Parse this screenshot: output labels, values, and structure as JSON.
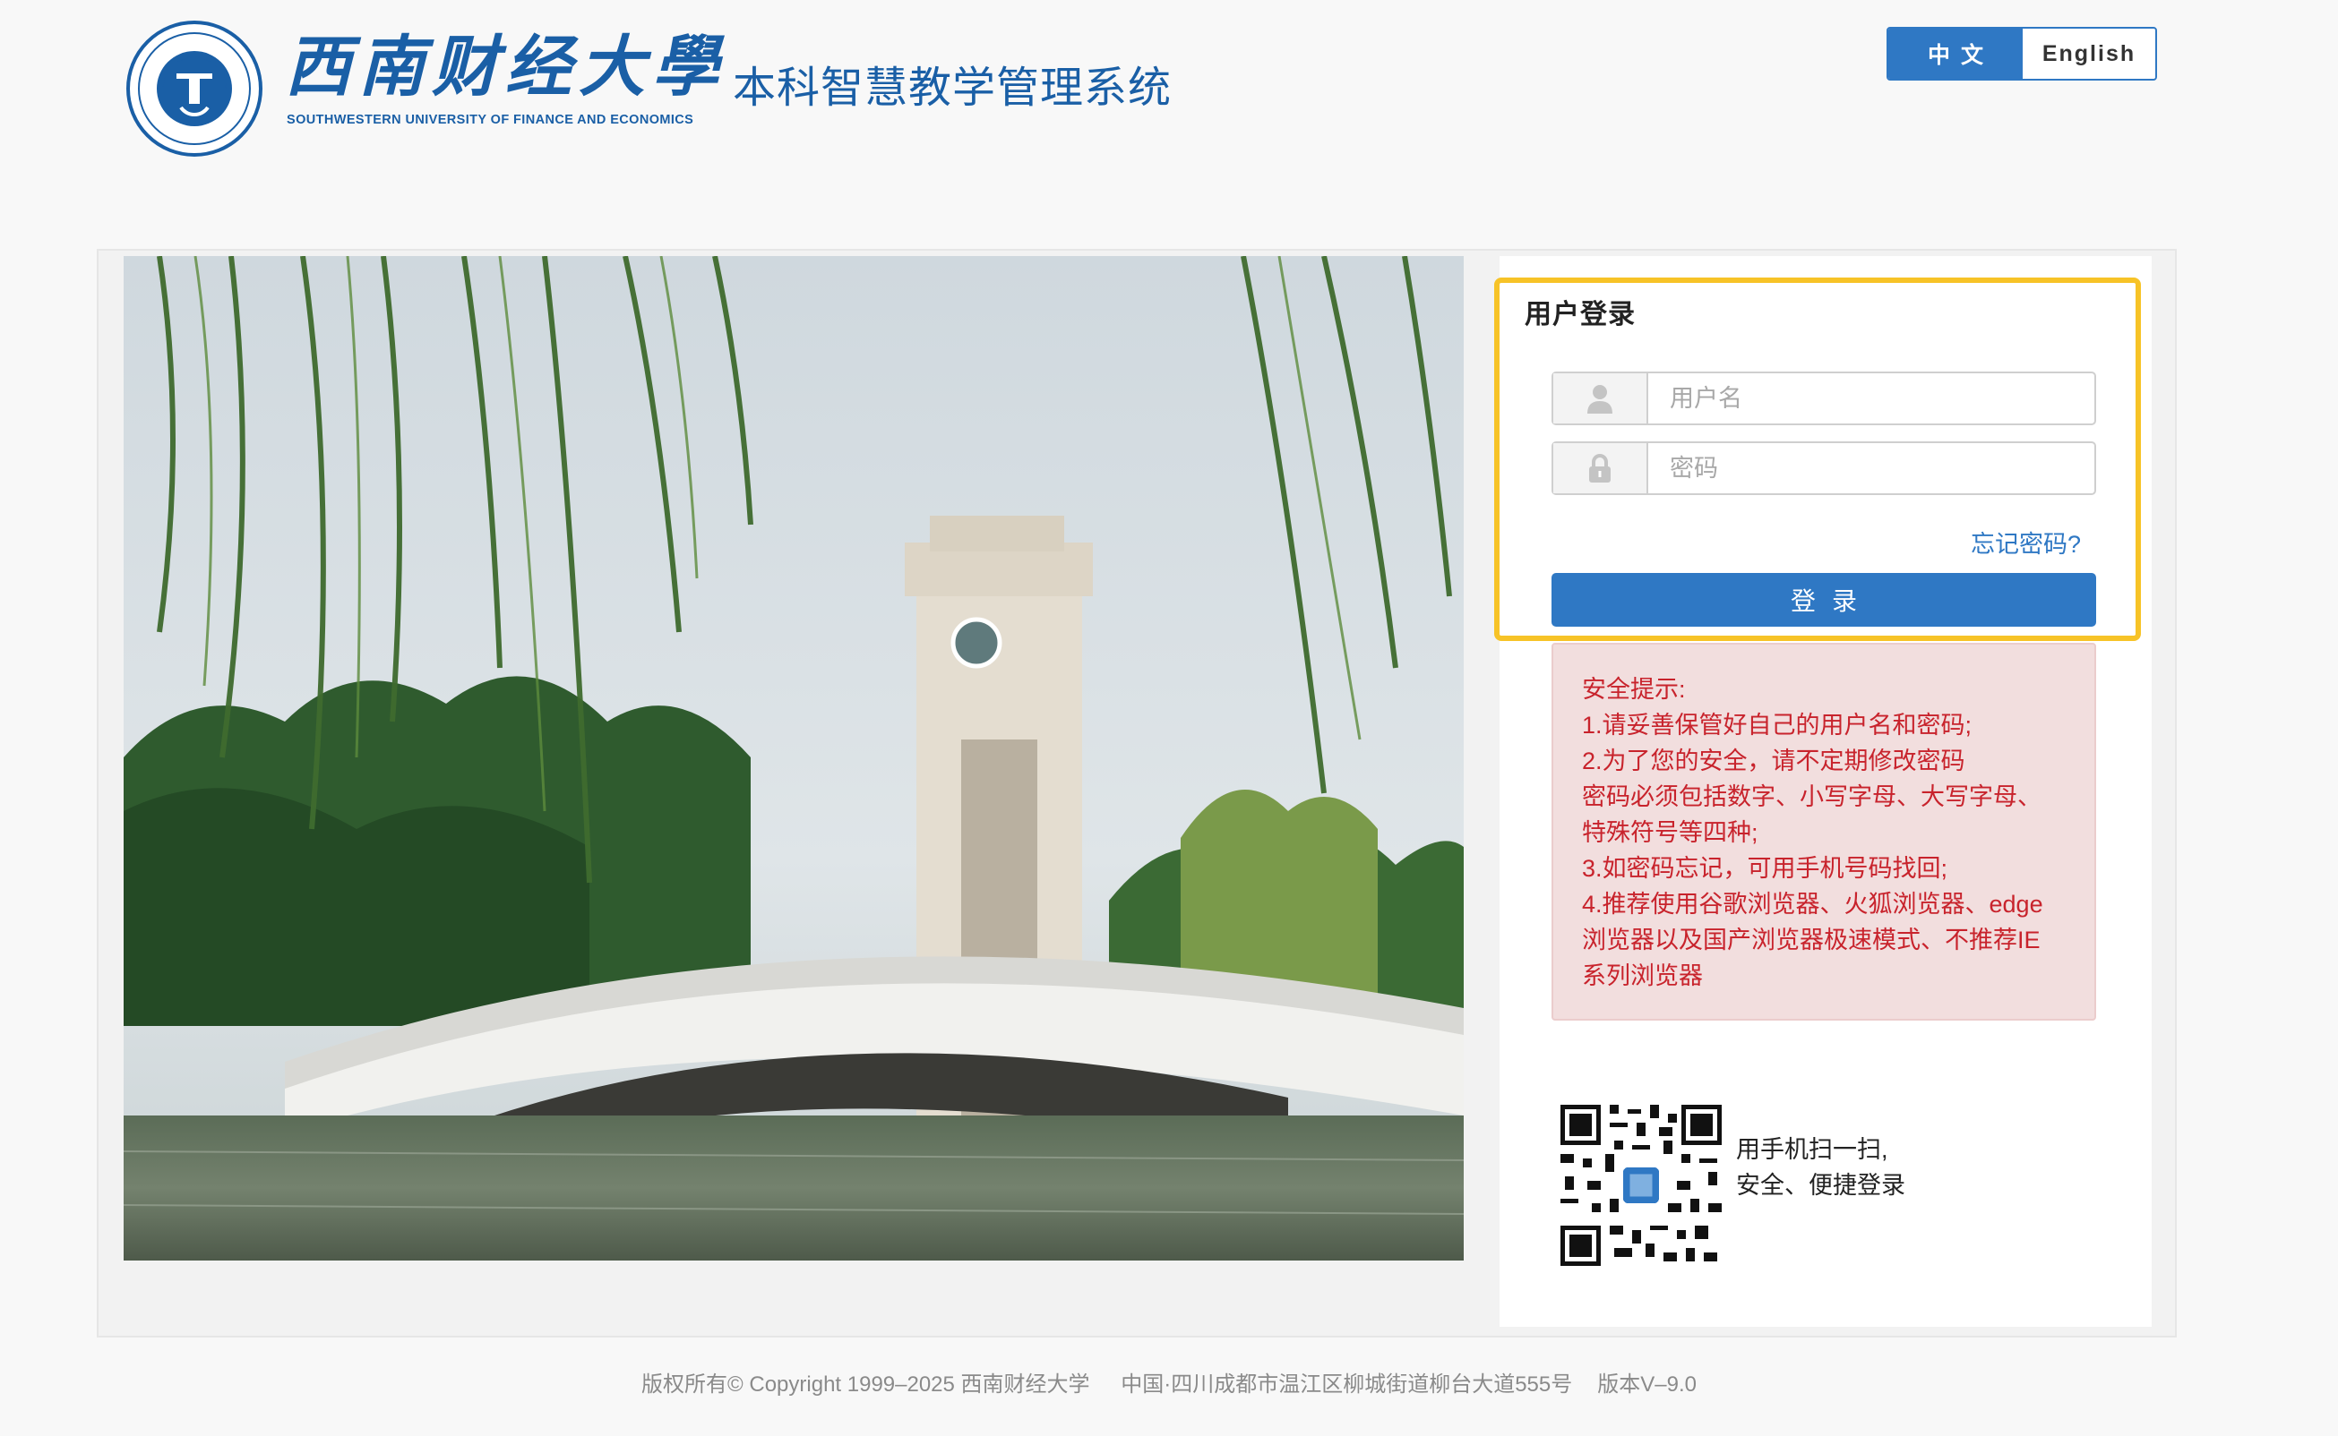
{
  "header": {
    "logo_seal_name": "university-seal-logo",
    "logo_cn": "西南财经大學",
    "logo_en": "SOUTHWESTERN UNIVERSITY OF FINANCE AND ECONOMICS",
    "system_title": "本科智慧教学管理系统",
    "lang": {
      "zh": "中文",
      "en": "English",
      "active": "zh"
    }
  },
  "login": {
    "title": "用户登录",
    "username_placeholder": "用户名",
    "password_placeholder": "密码",
    "forgot": "忘记密码?",
    "submit": "登录"
  },
  "notice": {
    "lines": [
      "安全提示:",
      "1.请妥善保管好自己的用户名和密码;",
      "2.为了您的安全，请不定期修改密码",
      "密码必须包括数字、小写字母、大写字母、",
      "特殊符号等四种;",
      "3.如密码忘记，可用手机号码找回;",
      "4.推荐使用谷歌浏览器、火狐浏览器、edge",
      "浏览器以及国产浏览器极速模式、不推荐IE",
      "系列浏览器"
    ]
  },
  "qr": {
    "line1": "用手机扫一扫,",
    "line2": "安全、便捷登录"
  },
  "footer": {
    "copyright": "版权所有© Copyright 1999–2025 西南财经大学",
    "address": "中国·四川成都市温江区柳城街道柳台大道555号",
    "version": "版本V–9.0"
  },
  "colors": {
    "brand_blue": "#1a5fa6",
    "button_blue": "#2f78c4",
    "highlight_yellow": "#f7c327",
    "notice_bg": "#f2dede",
    "notice_text": "#c8232c"
  }
}
